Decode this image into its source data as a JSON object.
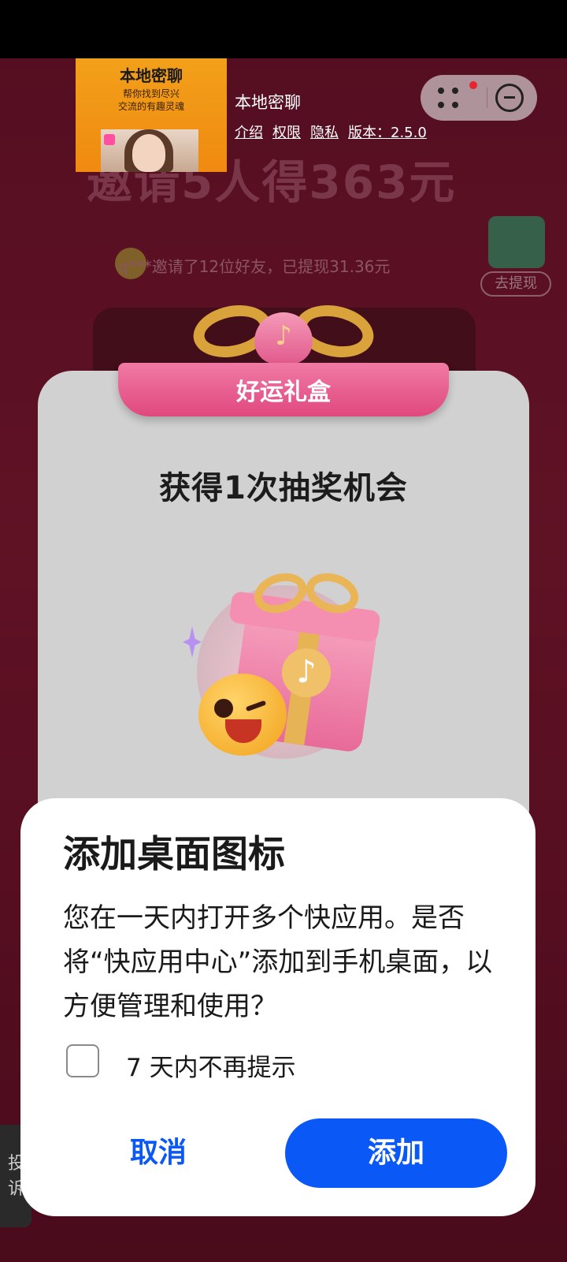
{
  "quick_app": {
    "thumbnail": {
      "title": "本地密聊",
      "subtitle_line1": "帮你找到尽兴",
      "subtitle_line2": "交流的有趣灵魂"
    },
    "name": "本地密聊",
    "links": [
      "介绍",
      "权限",
      "隐私",
      "版本：2.5.0"
    ],
    "capsule": {
      "menu_icon": "more-dots-icon",
      "close_icon": "minus-circle-icon",
      "notification_dot_color": "#e8242e"
    }
  },
  "background_page": {
    "headline": "邀请5人得363元",
    "ticker": "q***邀请了12位好友，已提现31.36元",
    "withdraw_button": "去提现",
    "left_tab": "投诉"
  },
  "gift_modal": {
    "banner": "好运礼盒",
    "title": "获得1次抽奖机会",
    "art": "gift-box-emoji-illustration"
  },
  "dialog": {
    "title": "添加桌面图标",
    "message": "您在一天内打开多个快应用。是否将“快应用中心”添加到手机桌面，以方便管理和使用？",
    "checkbox_label": "7 天内不再提示",
    "checkbox_checked": false,
    "cancel_label": "取消",
    "add_label": "添加",
    "accent_color": "#0a59f7"
  }
}
